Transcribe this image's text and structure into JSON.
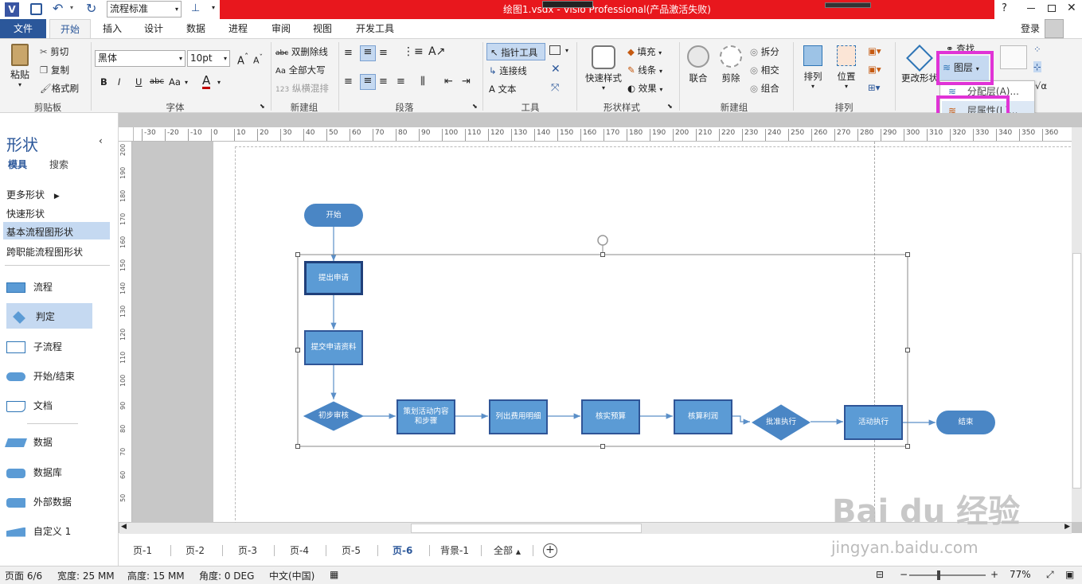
{
  "titlebar": {
    "title": "绘图1.vsdx - Visio Professional(产品激活失败)",
    "style_select": "流程标准",
    "help": "?",
    "logo": "V"
  },
  "tabs": [
    "文件",
    "开始",
    "插入",
    "设计",
    "数据",
    "进程",
    "审阅",
    "视图",
    "开发工具"
  ],
  "login": "登录",
  "ribbon": {
    "clipboard": {
      "paste": "粘贴",
      "cut": "剪切",
      "copy": "复制",
      "format_painter": "格式刷",
      "label": "剪贴板"
    },
    "font": {
      "name": "黑体",
      "size": "10pt",
      "label": "字体",
      "bold": "B",
      "italic": "I",
      "underline": "U",
      "strike": "abc",
      "aa": "Aa",
      "a_color": "A"
    },
    "newgroup1": {
      "double_strike": "双删除线",
      "all_caps": "全部大写",
      "vertical_mix": "纵横混排",
      "label": "新建组"
    },
    "paragraph": {
      "label": "段落"
    },
    "tools": {
      "pointer": "指针工具",
      "connector": "连接线",
      "text": "文本",
      "label": "工具"
    },
    "shape_styles": {
      "quick": "快速样式",
      "fill": "填充",
      "line": "线条",
      "effect": "效果",
      "label": "形状样式"
    },
    "newgroup2": {
      "union": "联合",
      "fragment": "剪除",
      "split": "拆分",
      "intersect": "相交",
      "combine": "组合",
      "label": "新建组"
    },
    "arrange": {
      "arrange": "排列",
      "position": "位置",
      "label": "排列"
    },
    "edit": {
      "change_shape": "更改形状",
      "find": "查找",
      "layers": "图层",
      "assign_layer": "分配层(A)...",
      "layer_props": "层属性(L)..."
    }
  },
  "shapes_panel": {
    "title": "形状",
    "stencil_tab": "模具",
    "search_tab": "搜索",
    "more": "更多形状",
    "quick": "快速形状",
    "basic_flow": "基本流程图形状",
    "cross_func": "跨职能流程图形状",
    "items": [
      "流程",
      "判定",
      "子流程",
      "开始/结束",
      "文档",
      "数据",
      "数据库",
      "外部数据",
      "自定义 1"
    ]
  },
  "hruler_labels": [
    "-30",
    "-20",
    "-10",
    "0",
    "10",
    "20",
    "30",
    "40",
    "50",
    "60",
    "70",
    "80",
    "90",
    "100",
    "110",
    "120",
    "130",
    "140",
    "150",
    "160",
    "170",
    "180",
    "190",
    "200",
    "210",
    "220",
    "230",
    "240",
    "250",
    "260",
    "270",
    "280",
    "290",
    "300",
    "310",
    "320",
    "330",
    "340",
    "350",
    "360"
  ],
  "vruler_labels": [
    "200",
    "190",
    "180",
    "170",
    "160",
    "150",
    "140",
    "130",
    "120",
    "110",
    "100",
    "90",
    "80",
    "70",
    "60",
    "50"
  ],
  "flow": {
    "start": "开始",
    "submit": "提出申请",
    "materials": "提交申请资料",
    "review": "初步审核",
    "plan": "策划活动内容和步骤",
    "costs": "列出费用明细",
    "budget": "核实预算",
    "profit": "核算利润",
    "approve": "批准执行",
    "execute": "活动执行",
    "end": "结束"
  },
  "page_tabs": [
    "页-1",
    "页-2",
    "页-3",
    "页-4",
    "页-5",
    "页-6",
    "背景-1",
    "全部"
  ],
  "status": {
    "page": "页面 6/6",
    "width": "宽度: 25 MM",
    "height": "高度: 15 MM",
    "angle": "角度: 0 DEG",
    "lang": "中文(中国)",
    "zoom": "77%"
  },
  "watermark": {
    "line1": "Bai du 经验",
    "line2": "jingyan.baidu.com"
  },
  "colors": {
    "highlight": "#e033d6",
    "accent": "#2b579a",
    "title_red": "#e8171d",
    "shape_fill": "#5b9bd5"
  }
}
